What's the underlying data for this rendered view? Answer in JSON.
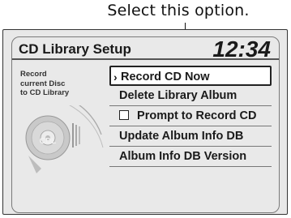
{
  "callout": {
    "text": "Select this option."
  },
  "screen": {
    "title": "CD Library Setup",
    "clock": "12:34",
    "side_text": [
      "Record",
      "current Disc",
      "to CD Library"
    ],
    "disc_logo": "CDL"
  },
  "menu": {
    "items": [
      {
        "label": "Record CD Now",
        "selected": true
      },
      {
        "label": "Delete Library Album",
        "selected": false
      },
      {
        "label": "Prompt to Record CD",
        "checkbox": true,
        "checked": false
      },
      {
        "label": "Update Album Info DB",
        "selected": false
      },
      {
        "label": "Album Info DB Version",
        "selected": false
      }
    ]
  }
}
